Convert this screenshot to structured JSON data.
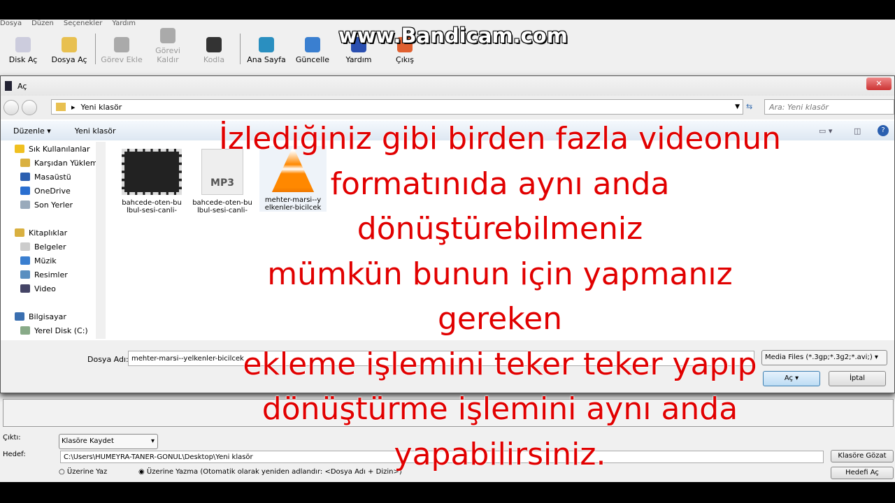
{
  "menu": [
    "Dosya",
    "Düzen",
    "Seçenekler",
    "Yardım"
  ],
  "toolbar": [
    {
      "label": "Disk Aç",
      "icon": "disc-icon",
      "enabled": true
    },
    {
      "label": "Dosya Aç",
      "icon": "folder-open-icon",
      "enabled": true
    },
    {
      "label": "Görev Ekle",
      "icon": "plus-icon",
      "enabled": false
    },
    {
      "label": "Görevi Kaldır",
      "icon": "minus-icon",
      "enabled": false
    },
    {
      "label": "Kodla",
      "icon": "encode-icon",
      "enabled": false
    },
    {
      "label": "Ana Sayfa",
      "icon": "globe-icon",
      "enabled": true
    },
    {
      "label": "Güncelle",
      "icon": "refresh-icon",
      "enabled": true
    },
    {
      "label": "Yardım",
      "icon": "help-icon",
      "enabled": true
    },
    {
      "label": "Çıkış",
      "icon": "exit-icon",
      "enabled": true
    }
  ],
  "watermark": "www.Bandicam.com",
  "dialog": {
    "title": "Aç",
    "close": "✕",
    "path": "Yeni klasör",
    "search_placeholder": "Ara: Yeni klasör",
    "organize": "Düzenle ▾",
    "new_folder": "Yeni klasör",
    "nav": [
      {
        "label": "Sık Kullanılanlar",
        "level": 0,
        "color": "#f0c020"
      },
      {
        "label": "Karşıdan Yüklem",
        "level": 1,
        "color": "#d9b040"
      },
      {
        "label": "Masaüstü",
        "level": 1,
        "color": "#2b5fb0"
      },
      {
        "label": "OneDrive",
        "level": 1,
        "color": "#2a6fd0"
      },
      {
        "label": "Son Yerler",
        "level": 1,
        "color": "#9ab"
      },
      {
        "label": "",
        "level": -1
      },
      {
        "label": "Kitaplıklar",
        "level": 0,
        "color": "#d9b040"
      },
      {
        "label": "Belgeler",
        "level": 1,
        "color": "#ccc"
      },
      {
        "label": "Müzik",
        "level": 1,
        "color": "#3a7fd0"
      },
      {
        "label": "Resimler",
        "level": 1,
        "color": "#5a8fc0"
      },
      {
        "label": "Video",
        "level": 1,
        "color": "#446"
      },
      {
        "label": "",
        "level": -1
      },
      {
        "label": "Bilgisayar",
        "level": 0,
        "color": "#3a6fb0"
      },
      {
        "label": "Yerel Disk (C:)",
        "level": 1,
        "color": "#8a8"
      }
    ],
    "files": [
      {
        "name": "bahcede-oten-bu lbul-sesi-canli-",
        "type": "video"
      },
      {
        "name": "bahcede-oten-bu lbul-sesi-canli-",
        "type": "mp3",
        "badge": "MP3"
      },
      {
        "name": "mehter-marsi--y elkenler-bicilcek",
        "type": "vlc"
      }
    ],
    "filename_label": "Dosya Adı:",
    "filename": "mehter-marsi--yelkenler-bicilcek",
    "filter": "Media Files (*.3gp;*.3g2;*.avi;)",
    "open": "Aç",
    "cancel": "İptal"
  },
  "output": {
    "label": "Çıktı:",
    "mode": "Klasöre Kaydet",
    "target_label": "Hedef:",
    "target": "C:\\Users\\HÜMEYRA-TANER-GÖNÜL\\Desktop\\Yeni klasör",
    "browse": "Klasöre Gözat",
    "open_target": "Hedefi Aç",
    "overwrite": "Üzerine Yaz",
    "no_overwrite": "Üzerine Yazma (Otomatik olarak yeniden adlandır: <Dosya Adı + Dizin>)"
  },
  "caption": [
    "İzlediğiniz gibi birden fazla videonun",
    "formatınıda aynı anda dönüştürebilmeniz",
    "mümkün bunun için yapmanız gereken",
    "ekleme işlemini teker teker yapıp",
    "dönüştürme işlemini aynı anda",
    "yapabilirsiniz."
  ]
}
